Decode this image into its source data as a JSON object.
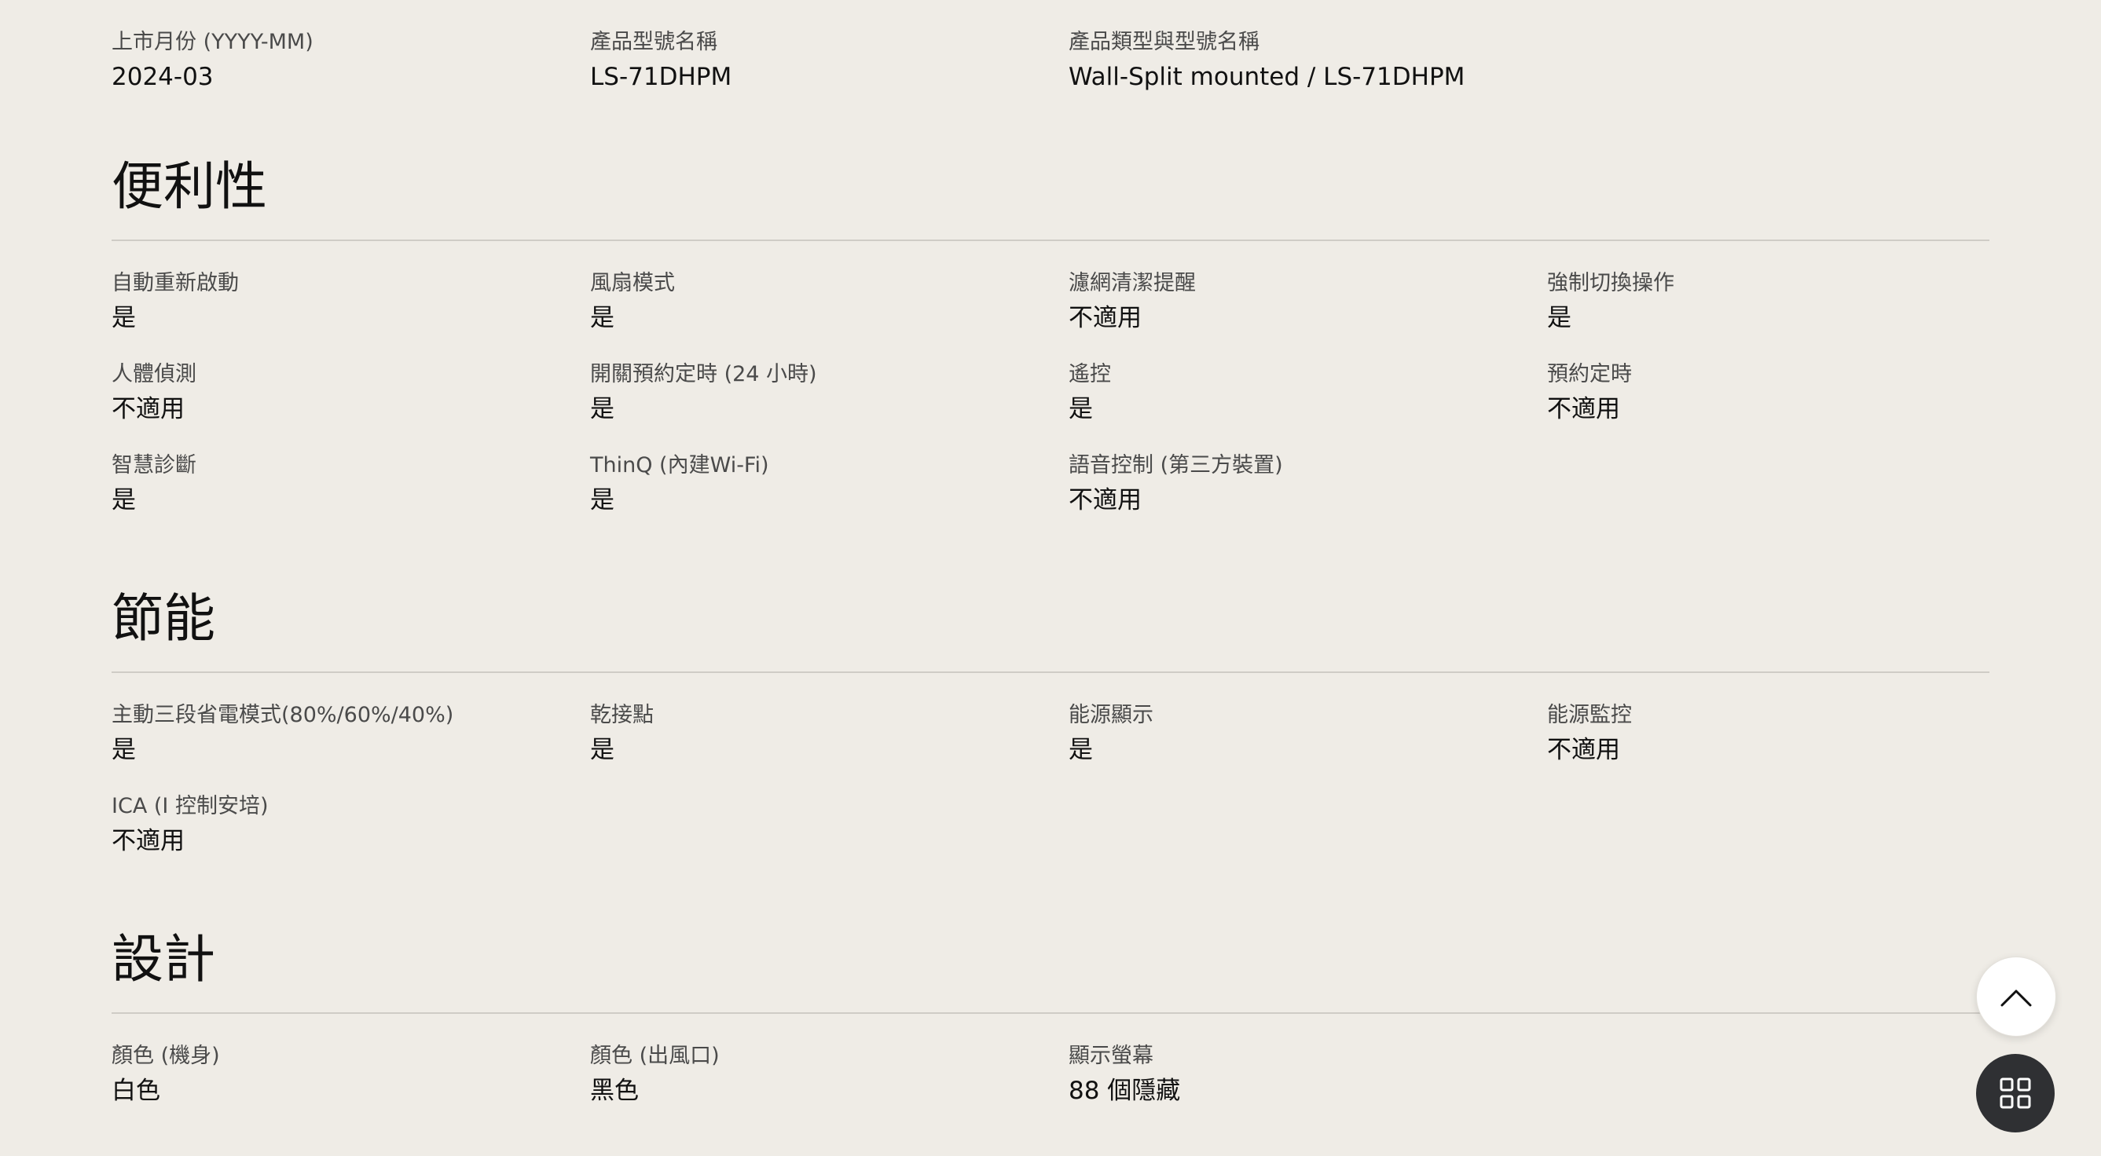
{
  "product_info": [
    {
      "label": "上市月份 (YYYY-MM)",
      "value": "2024-03"
    },
    {
      "label": "產品型號名稱",
      "value": "LS-71DHPM"
    },
    {
      "label": "產品類型與型號名稱",
      "value": "Wall-Split mounted / LS-71DHPM"
    }
  ],
  "sections": [
    {
      "title": "便利性",
      "specs": [
        {
          "label": "自動重新啟動",
          "value": "是"
        },
        {
          "label": "風扇模式",
          "value": "是"
        },
        {
          "label": "濾網清潔提醒",
          "value": "不適用"
        },
        {
          "label": "強制切換操作",
          "value": "是"
        },
        {
          "label": "人體偵測",
          "value": "不適用"
        },
        {
          "label": "開關預約定時 (24 小時)",
          "value": "是"
        },
        {
          "label": "遙控",
          "value": "是"
        },
        {
          "label": "預約定時",
          "value": "不適用"
        },
        {
          "label": "智慧診斷",
          "value": "是"
        },
        {
          "label": "ThinQ (內建Wi-Fi)",
          "value": "是"
        },
        {
          "label": "語音控制 (第三方裝置)",
          "value": "不適用"
        }
      ]
    },
    {
      "title": "節能",
      "specs": [
        {
          "label": "主動三段省電模式(80%/60%/40%)",
          "value": "是"
        },
        {
          "label": "乾接點",
          "value": "是"
        },
        {
          "label": "能源顯示",
          "value": "是"
        },
        {
          "label": "能源監控",
          "value": "不適用"
        },
        {
          "label": "ICA (I 控制安培)",
          "value": "不適用"
        }
      ]
    },
    {
      "title": "設計",
      "specs": [
        {
          "label": "顏色 (機身)",
          "value": "白色"
        },
        {
          "label": "顏色 (出風口)",
          "value": "黑色"
        },
        {
          "label": "顯示螢幕",
          "value": "88 個隱藏"
        }
      ]
    }
  ],
  "floating": {
    "scroll_top_icon": "chevron-up-icon",
    "menu_icon": "grid-icon"
  }
}
